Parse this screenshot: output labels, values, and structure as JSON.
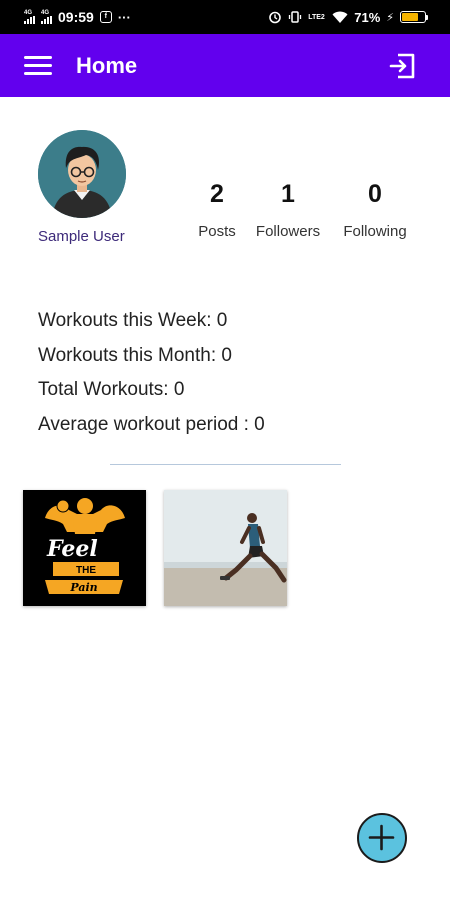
{
  "status_bar": {
    "time": "09:59",
    "more": "···",
    "network_label": "4G",
    "volte": "LTE2",
    "battery": "71%",
    "battery_level": 0.71
  },
  "app_bar": {
    "title": "Home",
    "menu_icon": "menu-icon",
    "logout_icon": "logout-icon",
    "color": "#6200ee"
  },
  "profile": {
    "username": "Sample User",
    "stats": [
      {
        "value": "2",
        "label": "Posts"
      },
      {
        "value": "1",
        "label": "Followers"
      },
      {
        "value": "0",
        "label": "Following"
      }
    ]
  },
  "workouts": {
    "week": "Workouts this Week: 0",
    "month": "Workouts this Month: 0",
    "total": "Total Workouts: 0",
    "average": "Average workout period : 0"
  },
  "posts": {
    "post1_text": [
      "Feel",
      "THE",
      "Pain"
    ]
  },
  "fab": {
    "icon": "add-icon",
    "color": "#5bc2df"
  }
}
